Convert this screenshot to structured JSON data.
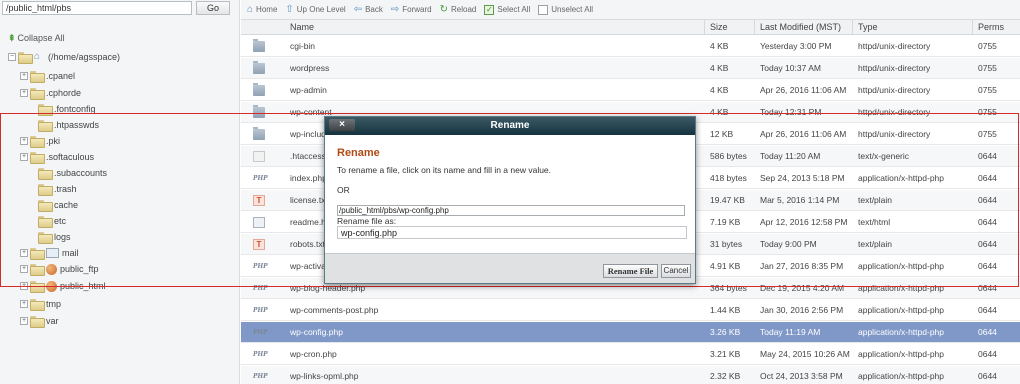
{
  "path_bar": {
    "value": "/public_html/pbs",
    "go_label": "Go"
  },
  "sidebar": {
    "collapse_label": "Collapse All",
    "tree": [
      {
        "label": "(/home/agsspace)",
        "icon": "home-icon",
        "expander": "−"
      },
      {
        "label": ".cpanel",
        "icon": "folder-icon",
        "expander": "+"
      },
      {
        "label": ".cphorde",
        "icon": "folder-icon",
        "expander": "+"
      },
      {
        "label": ".fontconfig",
        "icon": "folder-icon",
        "expander": ""
      },
      {
        "label": ".htpasswds",
        "icon": "folder-icon",
        "expander": ""
      },
      {
        "label": ".pki",
        "icon": "folder-icon",
        "expander": "+"
      },
      {
        "label": ".softaculous",
        "icon": "folder-icon",
        "expander": "+"
      },
      {
        "label": ".subaccounts",
        "icon": "folder-icon",
        "expander": ""
      },
      {
        "label": ".trash",
        "icon": "folder-icon",
        "expander": ""
      },
      {
        "label": "cache",
        "icon": "folder-icon",
        "expander": ""
      },
      {
        "label": "etc",
        "icon": "folder-icon",
        "expander": ""
      },
      {
        "label": "logs",
        "icon": "folder-icon",
        "expander": ""
      },
      {
        "label": "mail",
        "icon": "mail-folder-icon",
        "expander": "+"
      },
      {
        "label": "public_ftp",
        "icon": "ftp-folder-icon",
        "expander": "+"
      },
      {
        "label": "public_html",
        "icon": "web-folder-icon",
        "expander": "+"
      },
      {
        "label": "tmp",
        "icon": "folder-icon",
        "expander": "+"
      },
      {
        "label": "var",
        "icon": "folder-icon",
        "expander": "+"
      }
    ]
  },
  "toolbar": {
    "home": "Home",
    "up_one_level": "Up One Level",
    "back": "Back",
    "forward": "Forward",
    "reload": "Reload",
    "select_all": "Select All",
    "unselect_all": "Unselect All"
  },
  "table": {
    "headers": {
      "name": "Name",
      "size": "Size",
      "modified": "Last Modified (MST)",
      "type": "Type",
      "perms": "Perms"
    },
    "rows": [
      {
        "icon": "directory-icon",
        "name": "cgi-bin",
        "size": "4 KB",
        "modified": "Yesterday 3:00 PM",
        "type": "httpd/unix-directory",
        "perms": "0755"
      },
      {
        "icon": "directory-icon",
        "name": "wordpress",
        "size": "4 KB",
        "modified": "Today 10:37 AM",
        "type": "httpd/unix-directory",
        "perms": "0755"
      },
      {
        "icon": "directory-icon",
        "name": "wp-admin",
        "size": "4 KB",
        "modified": "Apr 26, 2016 11:06 AM",
        "type": "httpd/unix-directory",
        "perms": "0755"
      },
      {
        "icon": "directory-icon",
        "name": "wp-content",
        "size": "4 KB",
        "modified": "Today 12:31 PM",
        "type": "httpd/unix-directory",
        "perms": "0755"
      },
      {
        "icon": "directory-icon",
        "name": "wp-includes",
        "size": "12 KB",
        "modified": "Apr 26, 2016 11:06 AM",
        "type": "httpd/unix-directory",
        "perms": "0755"
      },
      {
        "icon": "generic-file-icon",
        "name": ".htaccess",
        "size": "586 bytes",
        "modified": "Today 11:20 AM",
        "type": "text/x-generic",
        "perms": "0644"
      },
      {
        "icon": "php-file-icon",
        "name": "index.php",
        "size": "418 bytes",
        "modified": "Sep 24, 2013 5:18 PM",
        "type": "application/x-httpd-php",
        "perms": "0644"
      },
      {
        "icon": "text-file-icon",
        "name": "license.txt",
        "size": "19.47 KB",
        "modified": "Mar 5, 2016 1:14 PM",
        "type": "text/plain",
        "perms": "0644"
      },
      {
        "icon": "html-file-icon",
        "name": "readme.html",
        "size": "7.19 KB",
        "modified": "Apr 12, 2016 12:58 PM",
        "type": "text/html",
        "perms": "0644"
      },
      {
        "icon": "text-file-icon",
        "name": "robots.txt",
        "size": "31 bytes",
        "modified": "Today 9:00 PM",
        "type": "text/plain",
        "perms": "0644"
      },
      {
        "icon": "php-file-icon",
        "name": "wp-activate.php",
        "size": "4.91 KB",
        "modified": "Jan 27, 2016 8:35 PM",
        "type": "application/x-httpd-php",
        "perms": "0644"
      },
      {
        "icon": "php-file-icon",
        "name": "wp-blog-header.php",
        "size": "364 bytes",
        "modified": "Dec 19, 2015 4:20 AM",
        "type": "application/x-httpd-php",
        "perms": "0644"
      },
      {
        "icon": "php-file-icon",
        "name": "wp-comments-post.php",
        "size": "1.44 KB",
        "modified": "Jan 30, 2016 2:56 PM",
        "type": "application/x-httpd-php",
        "perms": "0644"
      },
      {
        "icon": "php-file-icon",
        "name": "wp-config.php",
        "size": "3.26 KB",
        "modified": "Today 11:19 AM",
        "type": "application/x-httpd-php",
        "perms": "0644",
        "selected": true
      },
      {
        "icon": "php-file-icon",
        "name": "wp-cron.php",
        "size": "3.21 KB",
        "modified": "May 24, 2015 10:26 AM",
        "type": "application/x-httpd-php",
        "perms": "0644"
      },
      {
        "icon": "php-file-icon",
        "name": "wp-links-opml.php",
        "size": "2.32 KB",
        "modified": "Oct 24, 2013 3:58 PM",
        "type": "application/x-httpd-php",
        "perms": "0644"
      }
    ]
  },
  "rename_dialog": {
    "title": "Rename",
    "close_label": "×",
    "heading": "Rename",
    "instruction": "To rename a file, click on its name and fill in a new value.",
    "or_text": "OR",
    "current_path": "/public_html/pbs/wp-config.php",
    "field_label": "Rename file as:",
    "field_value": "wp-config.php",
    "rename_button": "Rename File",
    "cancel_button": "Cancel"
  },
  "colors": {
    "selected_row": "#7f98c8",
    "dialog_header": "#14333f",
    "dialog_heading": "#b24a16",
    "highlight_border": "#d42b2b"
  }
}
